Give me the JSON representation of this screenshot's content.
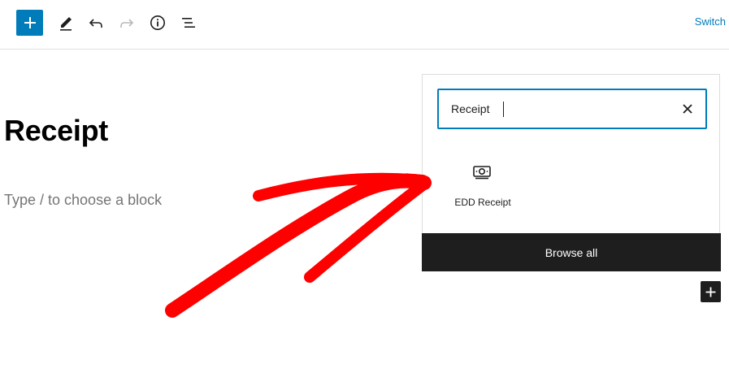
{
  "toolbar": {
    "inserter_icon": "plus-icon",
    "tools_icon": "pencil-icon",
    "undo_icon": "undo-icon",
    "redo_icon": "redo-icon",
    "details_icon": "info-icon",
    "list_view_icon": "list-view-icon",
    "switch_label": "Switch"
  },
  "editor": {
    "post_title": "Receipt",
    "block_placeholder": "Type / to choose a block"
  },
  "inserter": {
    "search_value": "Receipt",
    "clear_icon": "close-icon",
    "results": [
      {
        "label": "EDD Receipt",
        "icon": "money-receipt-icon"
      }
    ],
    "browse_all_label": "Browse all"
  },
  "appender": {
    "icon": "plus-icon"
  },
  "colors": {
    "accent": "#007cba",
    "dark": "#1e1e1e",
    "annotation": "#ff0000"
  }
}
